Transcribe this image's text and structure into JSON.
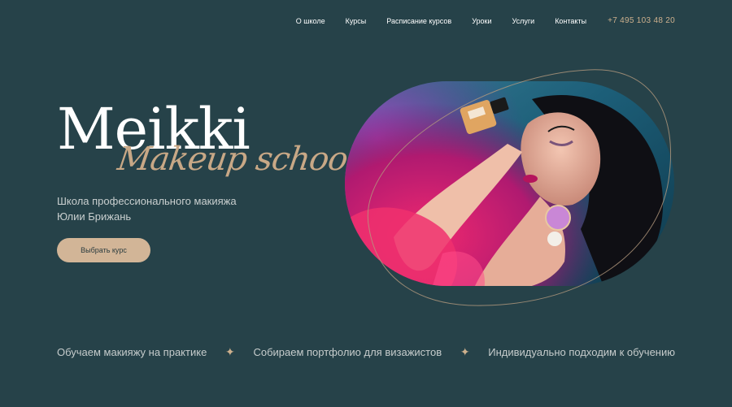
{
  "nav": {
    "items": [
      "О школе",
      "Курсы",
      "Расписание курсов",
      "Уроки",
      "Услуги",
      "Контакты"
    ],
    "phone": "+7 495 103 48 20"
  },
  "hero": {
    "title": "Meikki",
    "subtitle": "Makeup school",
    "tagline_line1": "Школа профессионального макияжа",
    "tagline_line2": "Юлии Брижань",
    "cta_label": "Выбрать курс",
    "image_alt": "woman-with-perfume-photo"
  },
  "features": [
    "Обучаем макияжу на практике",
    "Собираем портфолио для визажистов",
    "Индивидуально подходим к обучению"
  ],
  "icons": {
    "separator": "sparkle-icon"
  },
  "colors": {
    "background": "#264249",
    "accent": "#cdb08d",
    "button": "#d2b597",
    "text_light": "#ffffff",
    "text_muted": "#c9cfcf"
  }
}
